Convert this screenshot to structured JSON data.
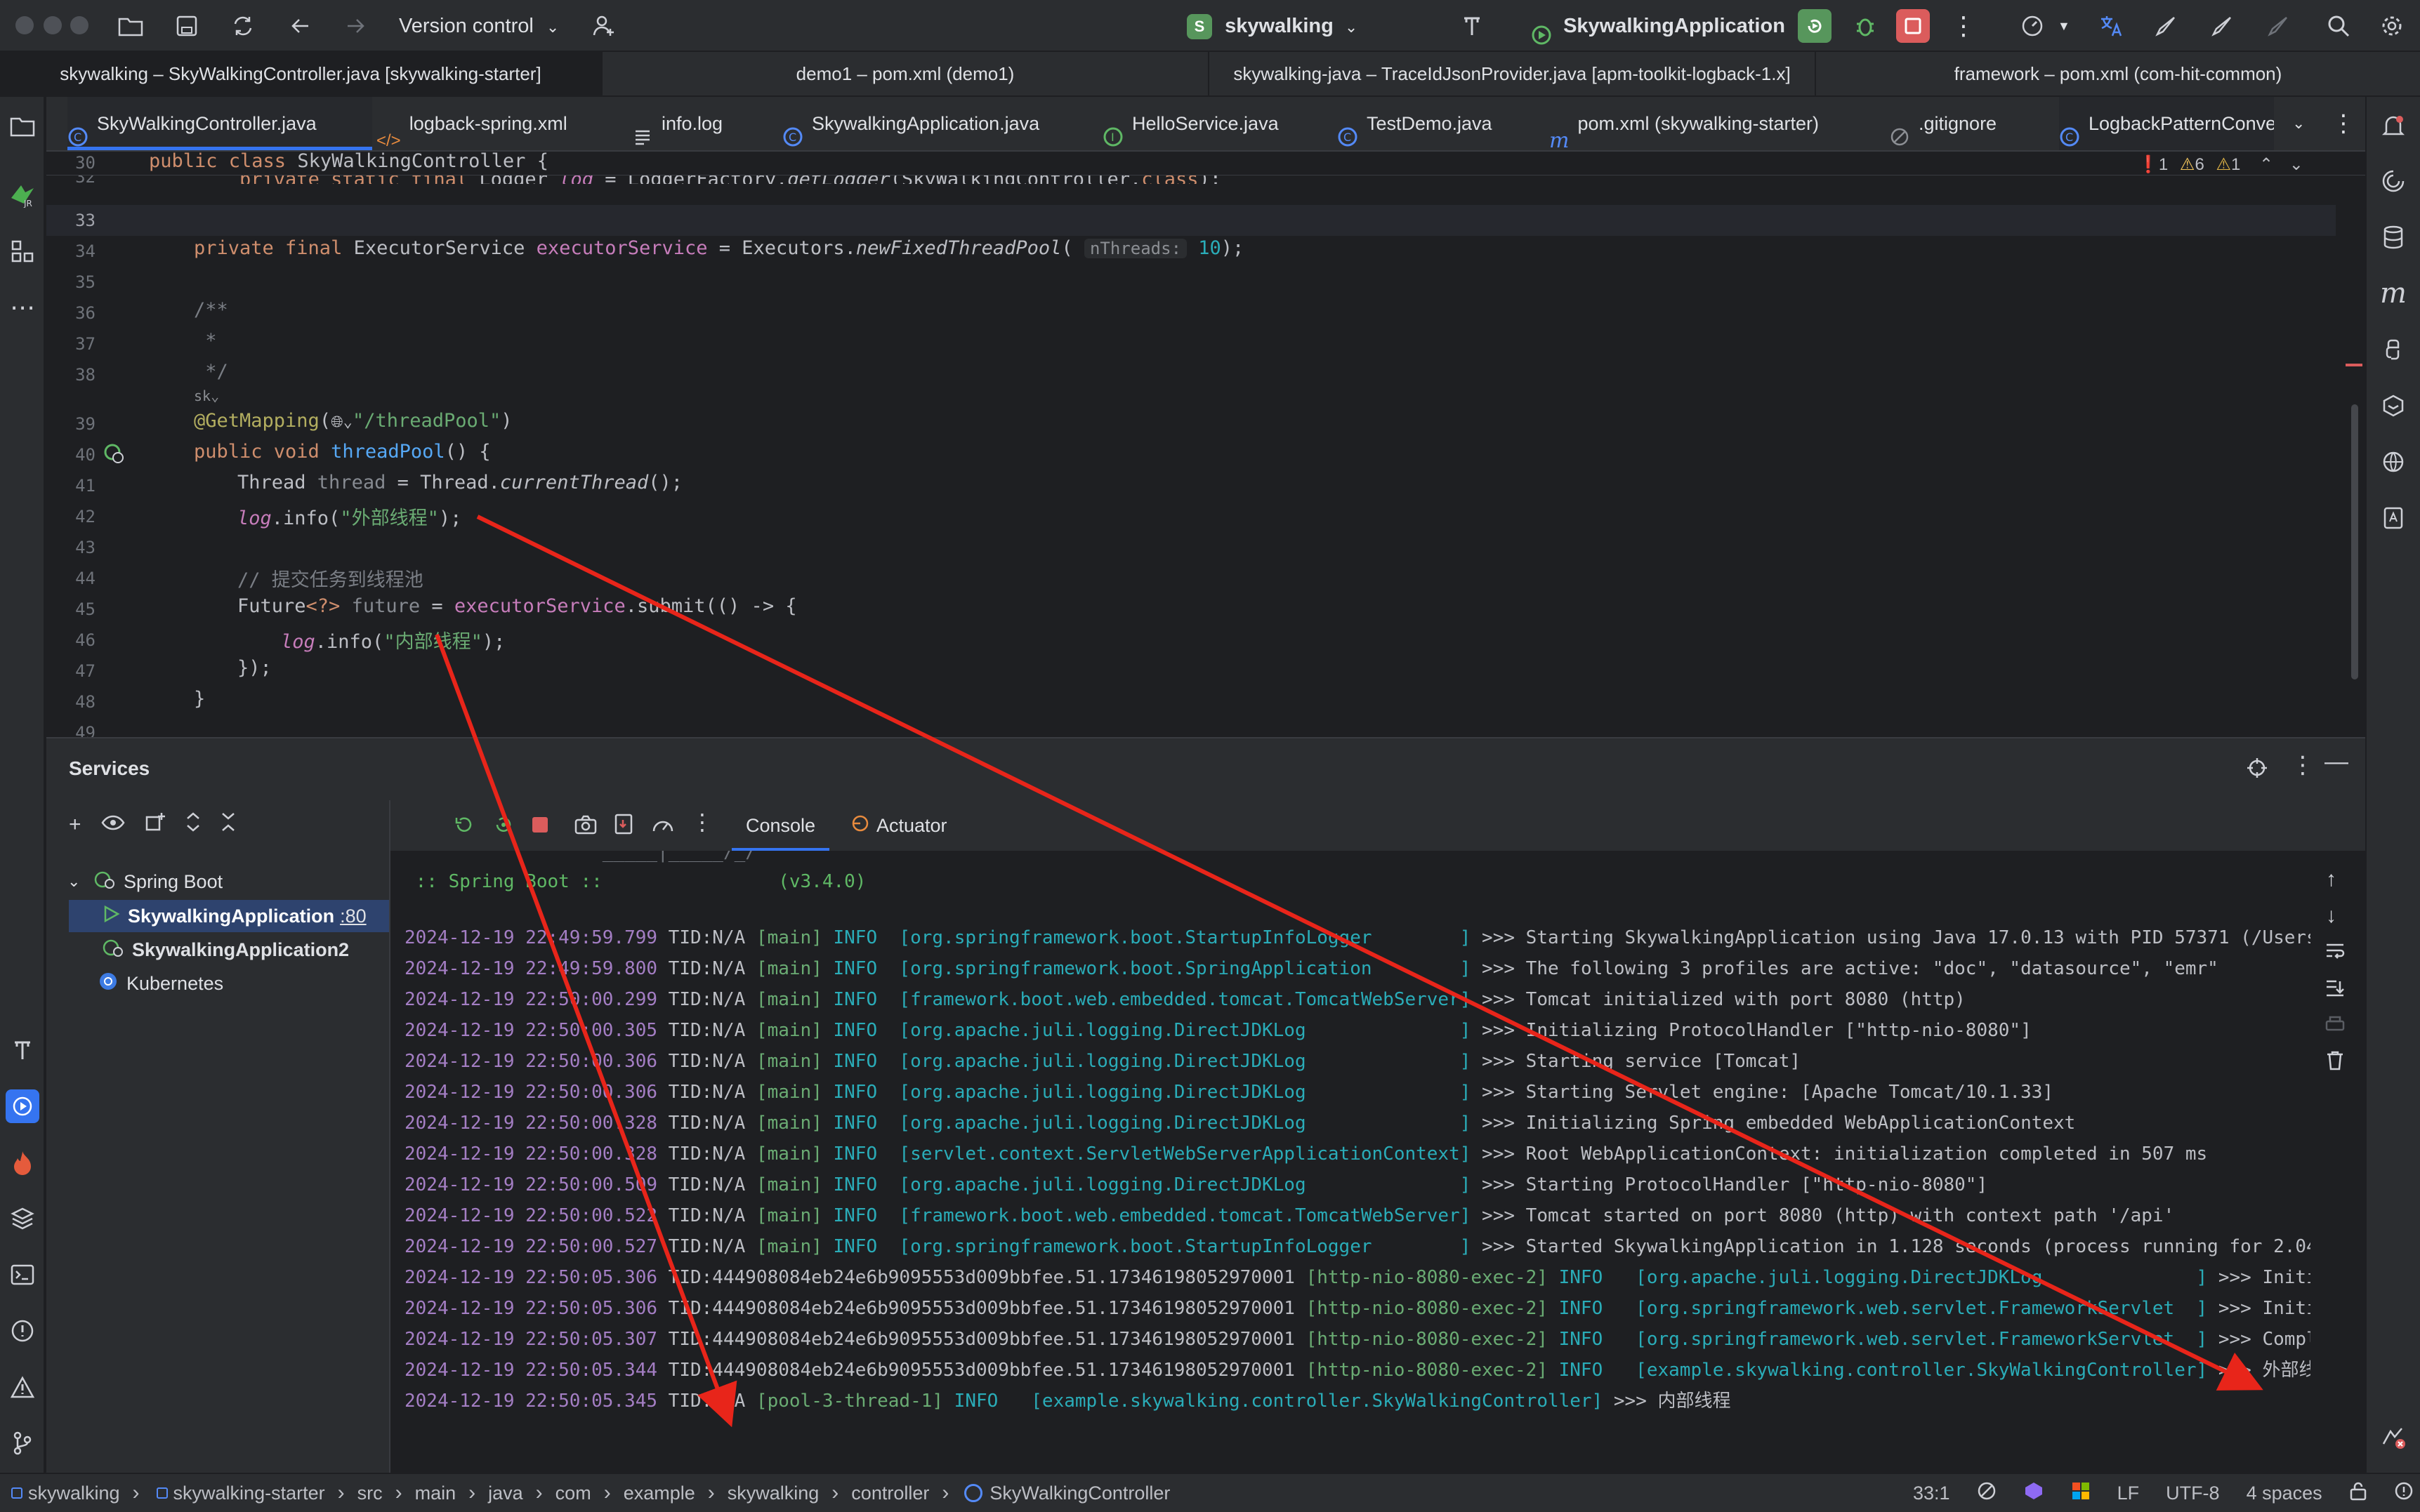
{
  "titlebar": {
    "vcs_label": "Version control",
    "project_badge": "S",
    "project_name": "skywalking",
    "run_config": "SkywalkingApplication"
  },
  "window_tabs": [
    "skywalking – SkyWalkingController.java [skywalking-starter]",
    "demo1 – pom.xml (demo1)",
    "skywalking-java – TraceIdJsonProvider.java [apm-toolkit-logback-1.x]",
    "framework – pom.xml (com-hit-common)"
  ],
  "editor_tabs": [
    {
      "label": "SkyWalkingController.java",
      "icon": "java-class-icon"
    },
    {
      "label": "logback-spring.xml",
      "icon": "xml-icon"
    },
    {
      "label": "info.log",
      "icon": "text-file-icon"
    },
    {
      "label": "SkywalkingApplication.java",
      "icon": "java-class-icon"
    },
    {
      "label": "HelloService.java",
      "icon": "java-interface-icon"
    },
    {
      "label": "TestDemo.java",
      "icon": "java-class-icon"
    },
    {
      "label": "pom.xml (skywalking-starter)",
      "icon": "maven-icon"
    },
    {
      "label": ".gitignore",
      "icon": "ignore-file-icon"
    },
    {
      "label": "LogbackPatternConve",
      "icon": "java-class-icon"
    }
  ],
  "inspections": {
    "errors": "1",
    "warnings": "6",
    "weak_warnings": "1"
  },
  "editor": {
    "sticky_line_number": "30",
    "sticky_code": "public class SkyWalkingController {",
    "lines": [
      {
        "n": "32",
        "t": "private static final Logger log = LoggerFactory.getLogger(SkyWalkingController.class);"
      },
      {
        "n": "33",
        "t": ""
      },
      {
        "n": "34",
        "t": "private final ExecutorService executorService = Executors.newFixedThreadPool( nThreads: 10);"
      },
      {
        "n": "35",
        "t": ""
      },
      {
        "n": "36",
        "t": "/**"
      },
      {
        "n": "37",
        "t": " *"
      },
      {
        "n": "38",
        "t": " */"
      },
      {
        "n": "39",
        "t": "@GetMapping(\"/threadPool\")"
      },
      {
        "n": "40",
        "t": "public void threadPool() {"
      },
      {
        "n": "41",
        "t": "Thread thread = Thread.currentThread();"
      },
      {
        "n": "42",
        "t": "log.info(\"外部线程\");"
      },
      {
        "n": "43",
        "t": ""
      },
      {
        "n": "44",
        "t": "// 提交任务到线程池"
      },
      {
        "n": "45",
        "t": "Future<?> future = executorService.submit(() -> {"
      },
      {
        "n": "46",
        "t": "log.info(\"内部线程\");"
      },
      {
        "n": "47",
        "t": "});"
      },
      {
        "n": "48",
        "t": "}"
      },
      {
        "n": "49",
        "t": ""
      }
    ],
    "param_hint": "nThreads:",
    "author_hint": "sk"
  },
  "services": {
    "title": "Services",
    "tree": [
      {
        "label": "Spring Boot",
        "level": 1
      },
      {
        "label": "SkywalkingApplication",
        "suffix": ":80",
        "level": 2,
        "selected": true
      },
      {
        "label": "SkywalkingApplication2",
        "level": 2
      },
      {
        "label": "Kubernetes",
        "level": 1
      }
    ],
    "console_tabs": [
      "Console",
      "Actuator"
    ]
  },
  "console": {
    "banner": " :: Spring Boot ::                (v3.4.0)",
    "lines": [
      {
        "ts": "2024-12-19 22:49:59.799",
        "tid": "TID:N/A",
        "thread": "[main]",
        "lvl": "INFO",
        "cls": "[org.springframework.boot.StartupInfoLogger        ]",
        "msg": ">>> Starting SkywalkingApplication using Java 17.0.13 with PID 57371 (/Users"
      },
      {
        "ts": "2024-12-19 22:49:59.800",
        "tid": "TID:N/A",
        "thread": "[main]",
        "lvl": "INFO",
        "cls": "[org.springframework.boot.SpringApplication        ]",
        "msg": ">>> The following 3 profiles are active: \"doc\", \"datasource\", \"emr\""
      },
      {
        "ts": "2024-12-19 22:50:00.299",
        "tid": "TID:N/A",
        "thread": "[main]",
        "lvl": "INFO",
        "cls": "[framework.boot.web.embedded.tomcat.TomcatWebServer]",
        "msg": ">>> Tomcat initialized with port 8080 (http)"
      },
      {
        "ts": "2024-12-19 22:50:00.305",
        "tid": "TID:N/A",
        "thread": "[main]",
        "lvl": "INFO",
        "cls": "[org.apache.juli.logging.DirectJDKLog              ]",
        "msg": ">>> Initializing ProtocolHandler [\"http-nio-8080\"]"
      },
      {
        "ts": "2024-12-19 22:50:00.306",
        "tid": "TID:N/A",
        "thread": "[main]",
        "lvl": "INFO",
        "cls": "[org.apache.juli.logging.DirectJDKLog              ]",
        "msg": ">>> Starting service [Tomcat]"
      },
      {
        "ts": "2024-12-19 22:50:00.306",
        "tid": "TID:N/A",
        "thread": "[main]",
        "lvl": "INFO",
        "cls": "[org.apache.juli.logging.DirectJDKLog              ]",
        "msg": ">>> Starting Servlet engine: [Apache Tomcat/10.1.33]"
      },
      {
        "ts": "2024-12-19 22:50:00.328",
        "tid": "TID:N/A",
        "thread": "[main]",
        "lvl": "INFO",
        "cls": "[org.apache.juli.logging.DirectJDKLog              ]",
        "msg": ">>> Initializing Spring embedded WebApplicationContext"
      },
      {
        "ts": "2024-12-19 22:50:00.328",
        "tid": "TID:N/A",
        "thread": "[main]",
        "lvl": "INFO",
        "cls": "[servlet.context.ServletWebServerApplicationContext]",
        "msg": ">>> Root WebApplicationContext: initialization completed in 507 ms"
      },
      {
        "ts": "2024-12-19 22:50:00.509",
        "tid": "TID:N/A",
        "thread": "[main]",
        "lvl": "INFO",
        "cls": "[org.apache.juli.logging.DirectJDKLog              ]",
        "msg": ">>> Starting ProtocolHandler [\"http-nio-8080\"]"
      },
      {
        "ts": "2024-12-19 22:50:00.522",
        "tid": "TID:N/A",
        "thread": "[main]",
        "lvl": "INFO",
        "cls": "[framework.boot.web.embedded.tomcat.TomcatWebServer]",
        "msg": ">>> Tomcat started on port 8080 (http) with context path '/api'"
      },
      {
        "ts": "2024-12-19 22:50:00.527",
        "tid": "TID:N/A",
        "thread": "[main]",
        "lvl": "INFO",
        "cls": "[org.springframework.boot.StartupInfoLogger        ]",
        "msg": ">>> Started SkywalkingApplication in 1.128 seconds (process running for 2.04"
      },
      {
        "ts": "2024-12-19 22:50:05.306",
        "tid": "TID:444908084eb24e6b9095553d009bbfee.51.17346198052970001",
        "thread": "[http-nio-8080-exec-2]",
        "lvl": "INFO",
        "cls": " [org.apache.juli.logging.DirectJDKLog              ]",
        "msg": ">>> Initia"
      },
      {
        "ts": "2024-12-19 22:50:05.306",
        "tid": "TID:444908084eb24e6b9095553d009bbfee.51.17346198052970001",
        "thread": "[http-nio-8080-exec-2]",
        "lvl": "INFO",
        "cls": " [org.springframework.web.servlet.FrameworkServlet  ]",
        "msg": ">>> Initia"
      },
      {
        "ts": "2024-12-19 22:50:05.307",
        "tid": "TID:444908084eb24e6b9095553d009bbfee.51.17346198052970001",
        "thread": "[http-nio-8080-exec-2]",
        "lvl": "INFO",
        "cls": " [org.springframework.web.servlet.FrameworkServlet  ]",
        "msg": ">>> Comple"
      },
      {
        "ts": "2024-12-19 22:50:05.344",
        "tid": "TID:444908084eb24e6b9095553d009bbfee.51.17346198052970001",
        "thread": "[http-nio-8080-exec-2]",
        "lvl": "INFO",
        "cls": " [example.skywalking.controller.SkyWalkingController]",
        "msg": ">>> 外部线程"
      },
      {
        "ts": "2024-12-19 22:50:05.345",
        "tid": "TID:N/A",
        "thread": "[pool-3-thread-1]",
        "lvl": "INFO",
        "cls": " [example.skywalking.controller.SkyWalkingController]",
        "msg": ">>> 内部线程"
      }
    ]
  },
  "statusbar": {
    "breadcrumb": [
      "skywalking",
      "skywalking-starter",
      "src",
      "main",
      "java",
      "com",
      "example",
      "skywalking",
      "controller",
      "SkyWalkingController"
    ],
    "position": "33:1",
    "line_sep": "LF",
    "encoding": "UTF-8",
    "indent": "4 spaces"
  },
  "colors": {
    "accent": "#3574f0",
    "run_green": "#57965c",
    "stop_red": "#db5c5c",
    "arrow_red": "#e8251a"
  }
}
